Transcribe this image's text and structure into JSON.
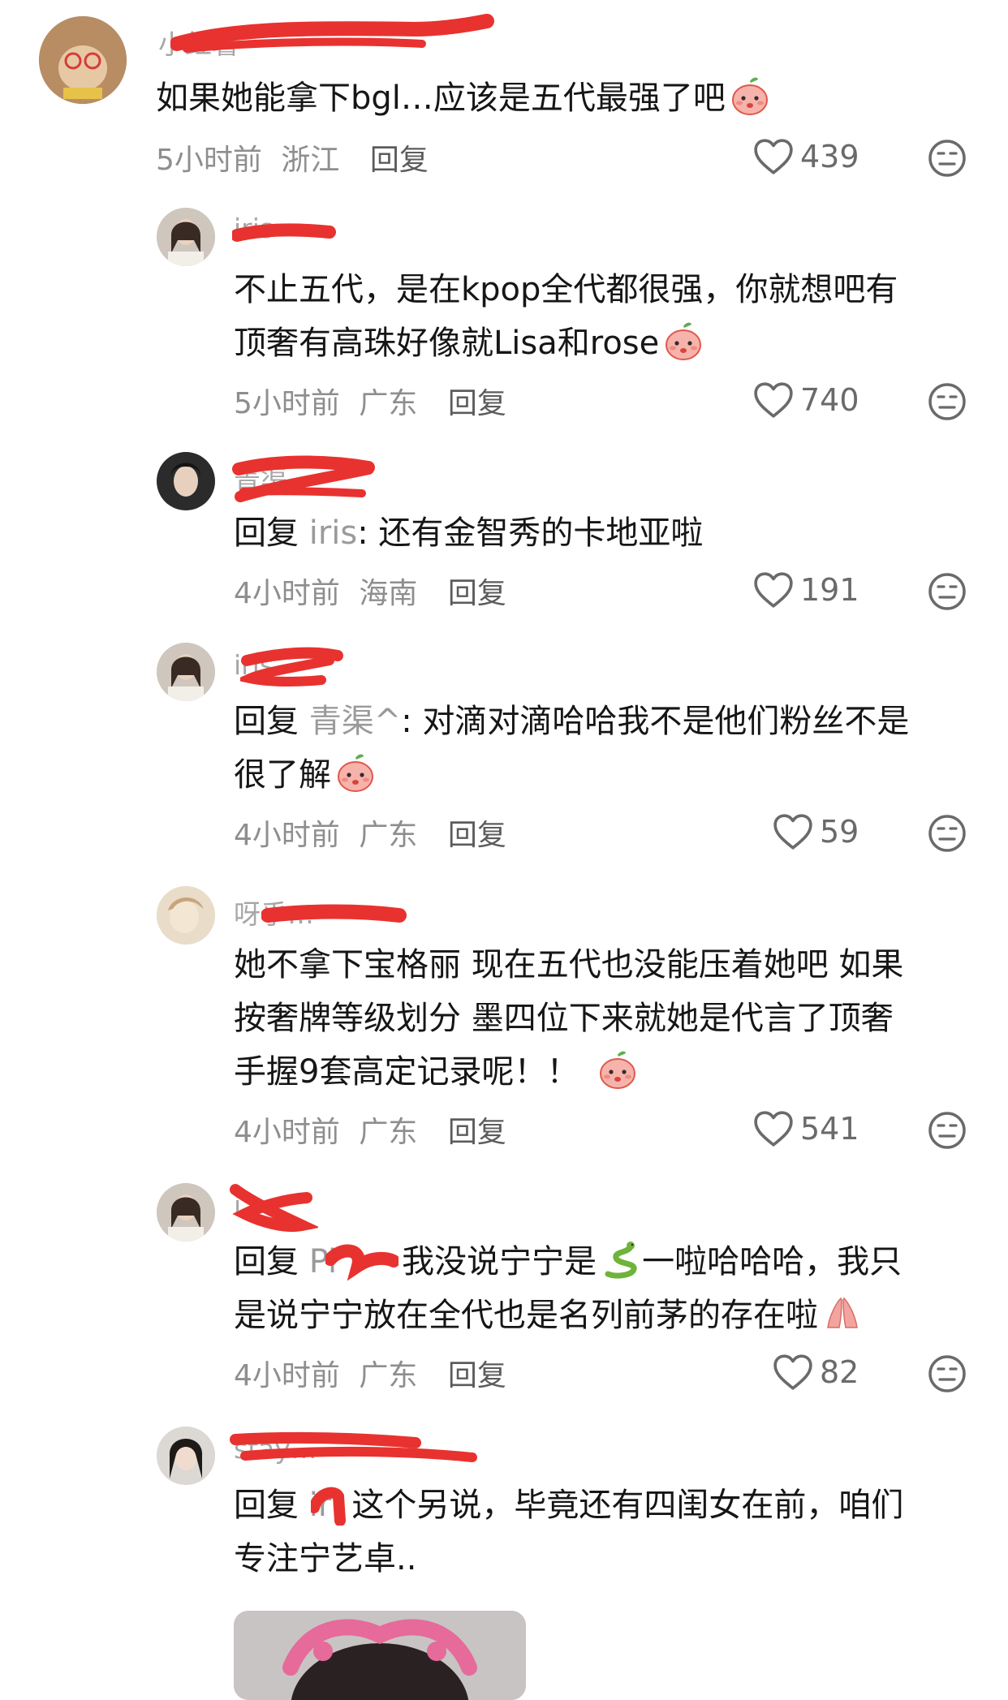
{
  "comments": [
    {
      "username": "小红薯",
      "text": "如果她能拿下bgl…应该是五代最强了吧",
      "time": "5小时前",
      "location": "浙江",
      "reply_label": "回复",
      "likes": "439"
    },
    {
      "username": "iris",
      "line1": "不止五代，是在kpop全代都很强，你就想吧有",
      "line2": "顶奢有高珠好像就Lisa和rose",
      "time": "5小时前",
      "location": "广东",
      "reply_label": "回复",
      "likes": "740"
    },
    {
      "username": "青渠",
      "reply_prefix": "回复",
      "reply_target": "iris",
      "text": ": 还有金智秀的卡地亚啦",
      "time": "4小时前",
      "location": "海南",
      "reply_label": "回复",
      "likes": "191"
    },
    {
      "username": "iris",
      "reply_prefix": "回复",
      "reply_target": "青渠^",
      "line1": ": 对滴对滴哈哈我不是他们粉丝不是",
      "line2": "很了解",
      "time": "4小时前",
      "location": "广东",
      "reply_label": "回复",
      "likes": "59"
    },
    {
      "username": "呀乎…",
      "line1": "她不拿下宝格丽 现在五代也没能压着她吧 如果",
      "line2": "按奢牌等级划分 墨四位下来就她是代言了顶奢",
      "line3": "手握9套高定记录呢！！",
      "time": "4小时前",
      "location": "广东",
      "reply_label": "回复",
      "likes": "541"
    },
    {
      "username": "i",
      "reply_prefix": "回复",
      "reply_target": "Pi",
      "line1": "我没说宁宁是",
      "line1b": "一啦哈哈哈，我只",
      "line2": "是说宁宁放在全代也是名列前茅的存在啦",
      "time": "4小时前",
      "location": "广东",
      "reply_label": "回复",
      "likes": "82"
    },
    {
      "username": "stay…",
      "reply_prefix": "回复",
      "reply_target": "iri",
      "line1": "这个另说，毕竟还有四闺女在前，咱们",
      "line2": "专注宁艺卓.."
    }
  ],
  "colors": {
    "scribble": "#e8322f",
    "text": "#161616",
    "meta": "#8e8e8e"
  },
  "icons": {
    "like": "heart-outline-icon",
    "dislike": "unamused-face-icon",
    "emoji_peach": "peach-face-emoji",
    "emoji_snake": "snake-emoji",
    "emoji_pray": "praying-hands-emoji"
  }
}
